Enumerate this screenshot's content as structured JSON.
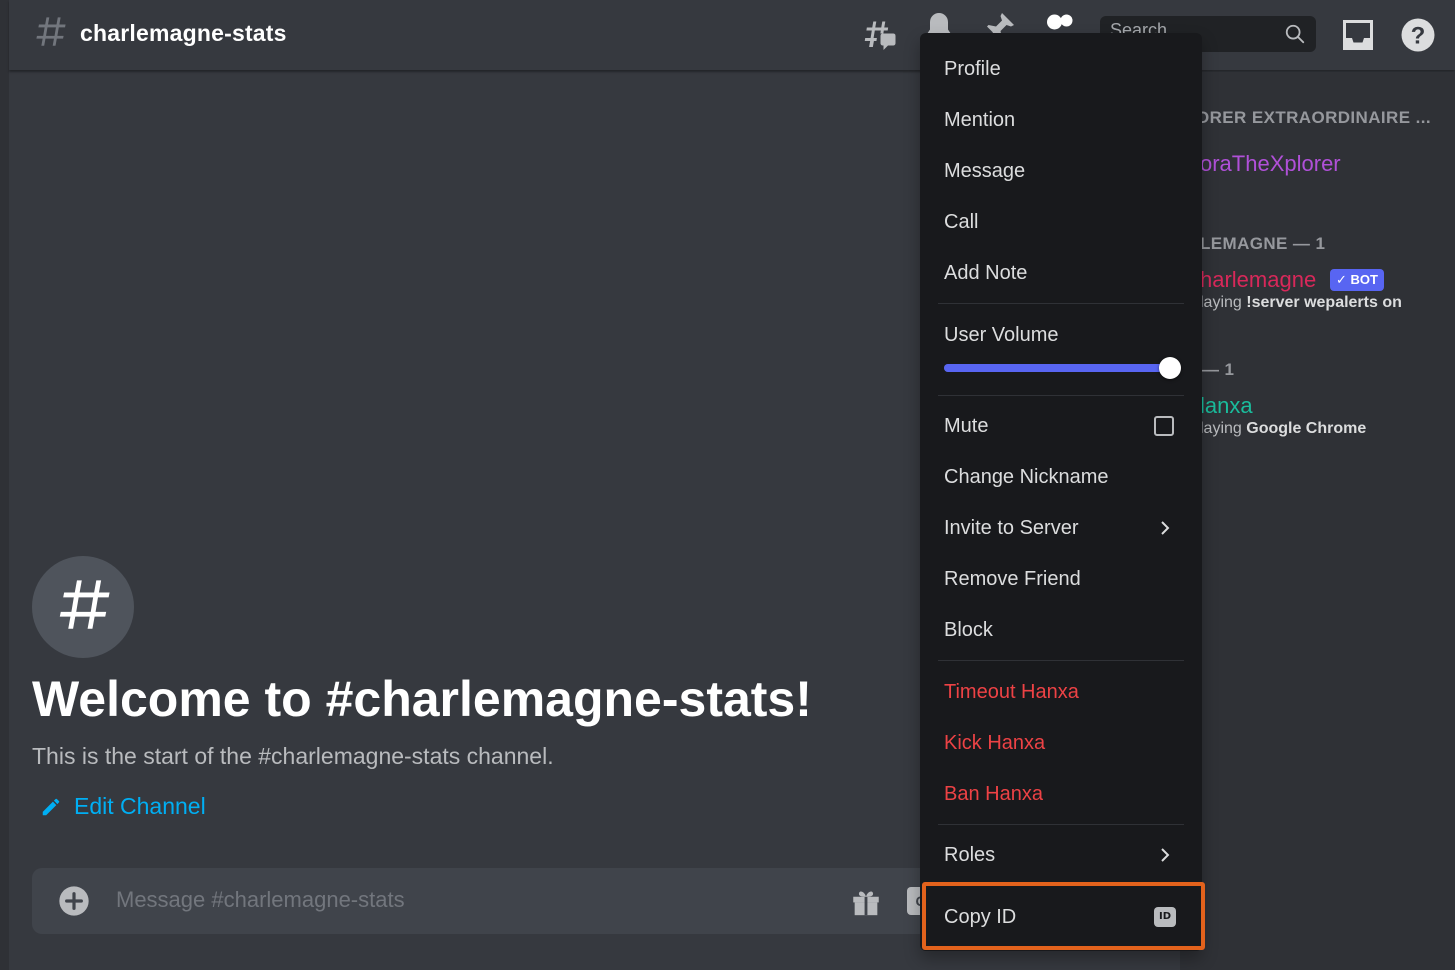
{
  "header": {
    "channel_name": "charlemagne-stats",
    "search_placeholder": "Search",
    "icons": [
      "threads-icon",
      "bell-icon",
      "pin-icon",
      "members-icon",
      "search-icon",
      "inbox-icon",
      "help-icon"
    ]
  },
  "members": {
    "categories": [
      {
        "label": "ORER EXTRAORDINAIRE ..."
      },
      {
        "label": "LEMAGNE — 1"
      },
      {
        "label": "— 1"
      }
    ],
    "items": [
      {
        "name": "oraTheXplorer",
        "color": "#b050d8"
      },
      {
        "name": "harlemagne",
        "color": "#d8285a",
        "tag": "BOT",
        "tag_check": "✓",
        "activity_prefix": "laying ",
        "activity": "!server wepalerts on"
      },
      {
        "name": "lanxa",
        "color": "#1abc9c",
        "activity_prefix": "laying ",
        "activity": "Google Chrome"
      }
    ]
  },
  "welcome": {
    "title": "Welcome to #charlemagne-stats!",
    "subtitle": "This is the start of the #charlemagne-stats channel.",
    "edit_label": "Edit Channel"
  },
  "composer": {
    "placeholder": "Message #charlemagne-stats",
    "gif_label": "G"
  },
  "context_menu": {
    "profile": "Profile",
    "mention": "Mention",
    "message": "Message",
    "call": "Call",
    "add_note": "Add Note",
    "user_volume": "User Volume",
    "volume_level": 1.0,
    "mute": "Mute",
    "mute_checked": false,
    "change_nickname": "Change Nickname",
    "invite_to_server": "Invite to Server",
    "remove_friend": "Remove Friend",
    "block": "Block",
    "timeout": "Timeout Hanxa",
    "kick": "Kick Hanxa",
    "ban": "Ban Hanxa",
    "roles": "Roles",
    "copy_id": "Copy ID",
    "id_badge": "ID",
    "highlight_color": "#e3621c",
    "danger_color": "#ed4245"
  }
}
